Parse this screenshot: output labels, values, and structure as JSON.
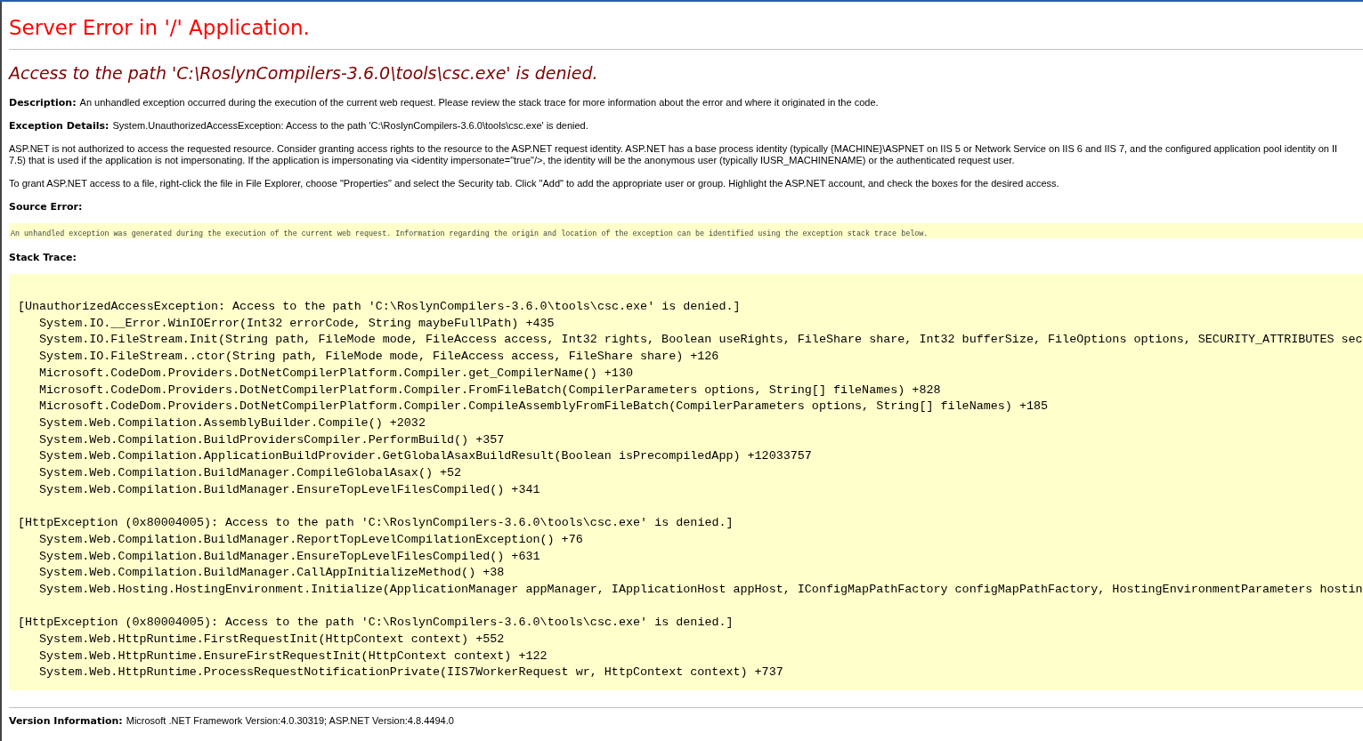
{
  "title": "Server Error in '/' Application.",
  "error_message": "Access to the path 'C:\\RoslynCompilers-3.6.0\\tools\\csc.exe' is denied.",
  "description": {
    "label": "Description:",
    "text": "An unhandled exception occurred during the execution of the current web request. Please review the stack trace for more information about the error and where it originated in the code."
  },
  "exception_details": {
    "label": "Exception Details:",
    "text": "System.UnauthorizedAccessException: Access to the path 'C:\\RoslynCompilers-3.6.0\\tools\\csc.exe' is denied."
  },
  "paragraphs": [
    {
      "lines": [
        "ASP.NET is not authorized to access the requested resource. Consider granting access rights to the resource to the ASP.NET request identity. ASP.NET has a base process identity (typically {MACHINE}\\ASPNET on IIS 5 or Network Service on IIS 6 and IIS 7, and the configured application pool identity on II",
        "7.5) that is used if the application is not impersonating. If the application is impersonating via <identity impersonate=\"true\"/>, the identity will be the anonymous user (typically IUSR_MACHINENAME) or the authenticated request user."
      ]
    },
    {
      "lines": [
        "To grant ASP.NET access to a file, right-click the file in File Explorer, choose \"Properties\" and select the Security tab. Click \"Add\" to add the appropriate user or group. Highlight the ASP.NET account, and check the boxes for the desired access."
      ]
    }
  ],
  "source_error": {
    "label": "Source Error:",
    "text": "An unhandled exception was generated during the execution of the current web request. Information regarding the origin and location of the exception can be identified using the exception stack trace below."
  },
  "stack_trace": {
    "label": "Stack Trace:",
    "blocks": [
      {
        "header": "[UnauthorizedAccessException: Access to the path 'C:\\RoslynCompilers-3.6.0\\tools\\csc.exe' is denied.]",
        "frames": [
          "System.IO.__Error.WinIOError(Int32 errorCode, String maybeFullPath) +435",
          "System.IO.FileStream.Init(String path, FileMode mode, FileAccess access, Int32 rights, Boolean useRights, FileShare share, Int32 bufferSize, FileOptions options, SECURITY_ATTRIBUTES sec",
          "System.IO.FileStream..ctor(String path, FileMode mode, FileAccess access, FileShare share) +126",
          "Microsoft.CodeDom.Providers.DotNetCompilerPlatform.Compiler.get_CompilerName() +130",
          "Microsoft.CodeDom.Providers.DotNetCompilerPlatform.Compiler.FromFileBatch(CompilerParameters options, String[] fileNames) +828",
          "Microsoft.CodeDom.Providers.DotNetCompilerPlatform.Compiler.CompileAssemblyFromFileBatch(CompilerParameters options, String[] fileNames) +185",
          "System.Web.Compilation.AssemblyBuilder.Compile() +2032",
          "System.Web.Compilation.BuildProvidersCompiler.PerformBuild() +357",
          "System.Web.Compilation.ApplicationBuildProvider.GetGlobalAsaxBuildResult(Boolean isPrecompiledApp) +12033757",
          "System.Web.Compilation.BuildManager.CompileGlobalAsax() +52",
          "System.Web.Compilation.BuildManager.EnsureTopLevelFilesCompiled() +341"
        ]
      },
      {
        "header": "[HttpException (0x80004005): Access to the path 'C:\\RoslynCompilers-3.6.0\\tools\\csc.exe' is denied.]",
        "frames": [
          "System.Web.Compilation.BuildManager.ReportTopLevelCompilationException() +76",
          "System.Web.Compilation.BuildManager.EnsureTopLevelFilesCompiled() +631",
          "System.Web.Compilation.BuildManager.CallAppInitializeMethod() +38",
          "System.Web.Hosting.HostingEnvironment.Initialize(ApplicationManager appManager, IApplicationHost appHost, IConfigMapPathFactory configMapPathFactory, HostingEnvironmentParameters hostin"
        ]
      },
      {
        "header": "[HttpException (0x80004005): Access to the path 'C:\\RoslynCompilers-3.6.0\\tools\\csc.exe' is denied.]",
        "frames": [
          "System.Web.HttpRuntime.FirstRequestInit(HttpContext context) +552",
          "System.Web.HttpRuntime.EnsureFirstRequestInit(HttpContext context) +122",
          "System.Web.HttpRuntime.ProcessRequestNotificationPrivate(IIS7WorkerRequest wr, HttpContext context) +737"
        ]
      }
    ]
  },
  "version_info": {
    "label": "Version Information:",
    "text": "Microsoft .NET Framework Version:4.0.30319; ASP.NET Version:4.8.4494.0"
  }
}
